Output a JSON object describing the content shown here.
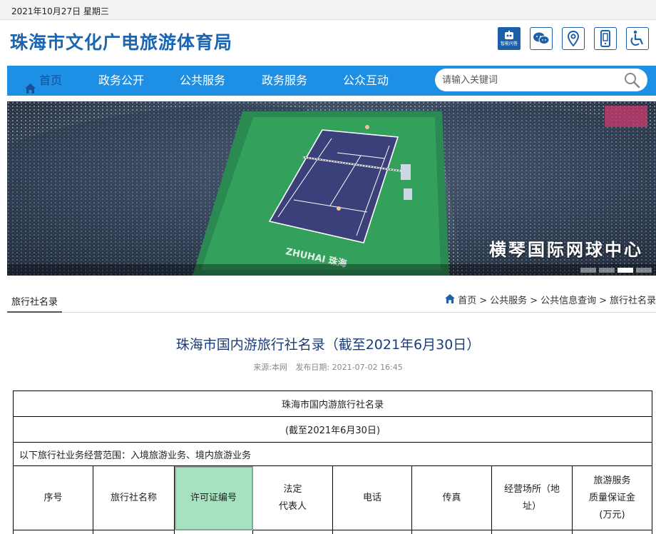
{
  "topbar": {
    "date": "2021年10月27日 星期三"
  },
  "header": {
    "site_title": "珠海市文化广电旅游体育局",
    "icons": [
      {
        "name": "robot-icon",
        "label": "智能问答"
      },
      {
        "name": "wechat-icon"
      },
      {
        "name": "location-icon"
      },
      {
        "name": "mobile-icon"
      },
      {
        "name": "accessibility-icon"
      }
    ]
  },
  "nav": {
    "items": [
      {
        "label": "首页",
        "active": true
      },
      {
        "label": "政务公开"
      },
      {
        "label": "公共服务"
      },
      {
        "label": "政务服务"
      },
      {
        "label": "公众互动"
      }
    ],
    "search_placeholder": "请输入关键词"
  },
  "banner": {
    "caption": "横琴国际网球中心",
    "court_text": "ZHUHAI 珠海",
    "active_slide": 3,
    "slide_count": 4
  },
  "section": {
    "tab": "旅行社名录"
  },
  "breadcrumb": [
    "首页",
    "公共服务",
    "公共信息查询",
    "旅行社名录"
  ],
  "article": {
    "title": "珠海市国内游旅行社名录（截至2021年6月30日）",
    "source": "来源:本网",
    "publish": "发布日期: 2021-07-02 16:45"
  },
  "table": {
    "title": "珠海市国内游旅行社名录",
    "subtitle": "(截至2021年6月30日)",
    "scope": "以下旅行社业务经营范围：入境旅游业务、境内旅游业务",
    "headers": [
      {
        "lines": [
          "序号"
        ]
      },
      {
        "lines": [
          "旅行社名称"
        ]
      },
      {
        "lines": [
          "许可证编号"
        ],
        "highlight": true
      },
      {
        "lines": [
          "法定",
          "代表人"
        ]
      },
      {
        "lines": [
          "电话"
        ]
      },
      {
        "lines": [
          "传真"
        ]
      },
      {
        "lines": [
          "经营场所（地",
          "址）"
        ]
      },
      {
        "lines": [
          "旅游服务",
          "质量保证金",
          "(万元)"
        ]
      }
    ]
  },
  "colors": {
    "nav_bg": "#1d8fe4",
    "title_blue": "#1a66b3",
    "highlight_cell": "#a6e2bf",
    "icon_blue": "#1d5fa8"
  }
}
